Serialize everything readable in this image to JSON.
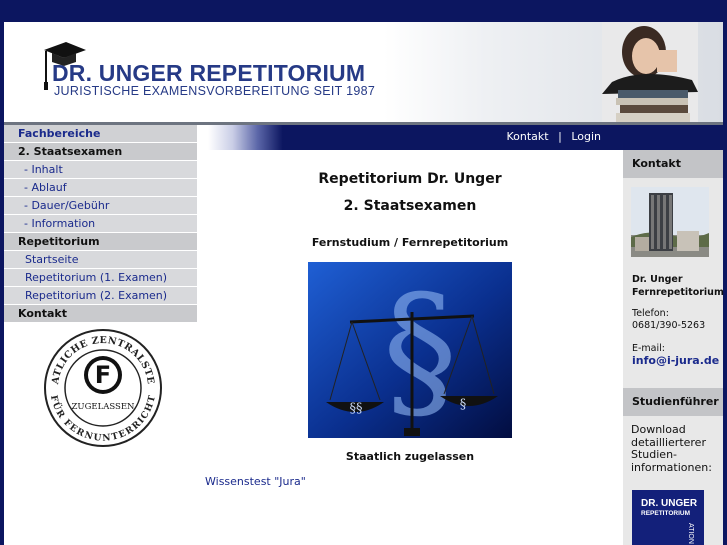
{
  "header": {
    "logo_title": "DR. UNGER REPETITORIUM",
    "logo_subtitle": "JURISTISCHE EXAMENSVORBEREITUNG SEIT 1987"
  },
  "top_nav": {
    "kontakt": "Kontakt",
    "separator": "|",
    "login": "Login"
  },
  "left_nav": {
    "fachbereiche": "Fachbereiche",
    "staatsexamen": "2. Staatsexamen",
    "inhalt": "- Inhalt",
    "ablauf": "- Ablauf",
    "dauer": "- Dauer/Gebühr",
    "information": "- Information",
    "repetitorium": "Repetitorium",
    "startseite": "Startseite",
    "rep1": "Repetitorium (1. Examen)",
    "rep2": "Repetitorium (2. Examen)",
    "kontakt": "Kontakt"
  },
  "seal": {
    "top_text": "STAATLICHE ZENTRALSTELLE",
    "bottom_text": "FÜR FERNUNTERRICHT",
    "center": "ZUGELASSEN",
    "letter": "F"
  },
  "main": {
    "title1": "Repetitorium Dr. Unger",
    "title2": "2. Staatsexamen",
    "subtitle": "Fernstudium / Fernrepetitorium",
    "caption": "Staatlich zugelassen",
    "link": "Wissenstest \"Jura\"",
    "symbol_large": "§",
    "symbol_left": "§§",
    "symbol_right": "§"
  },
  "right": {
    "kontakt_head": "Kontakt",
    "name1": "Dr.  Unger",
    "name2": "Fernrepetitorium",
    "tel_label": "Telefon:",
    "tel": "0681/390-5263",
    "mail_label": "E-mail:",
    "mail": "info@i-jura.de",
    "guide_head": "Studienführer",
    "download1": "Download",
    "download2": "detaillierterer",
    "download3": "Studien-",
    "download4": "informationen:",
    "book1": "DR. UNGER",
    "book2": "REPETITORIUM",
    "book3": "ATION"
  },
  "colors": {
    "navy": "#0c1660",
    "link": "#1a2a8c",
    "logo": "#263a86"
  }
}
